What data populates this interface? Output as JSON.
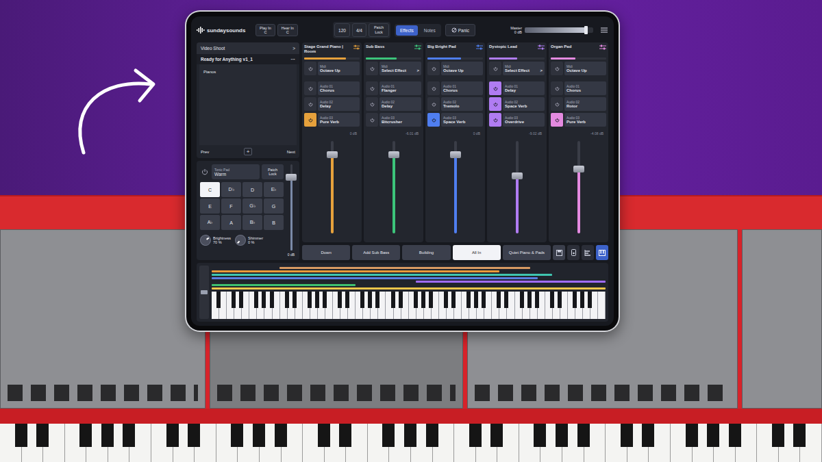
{
  "app": {
    "logo": "sundaysounds",
    "play_in": {
      "label": "Play In",
      "value": "C"
    },
    "hear_in": {
      "label": "Hear In",
      "value": "C"
    },
    "tempo": "120",
    "meter": "4/4",
    "patch_lock": "Patch Lock",
    "view_tabs": [
      {
        "label": "Effects",
        "selected": true
      },
      {
        "label": "Notes",
        "selected": false
      }
    ],
    "panic": "Panic",
    "master": {
      "label": "Master",
      "reading": "0 dB",
      "level": 0.9
    }
  },
  "setlist": {
    "title": "Video Shoot",
    "chevron": ">",
    "song": "Ready for Anything v1_1",
    "more": "···",
    "items": [
      "Pianos"
    ],
    "prev": "Prev",
    "add": "+",
    "next": "Next"
  },
  "tonic_pad": {
    "label": "Tonic Pad",
    "value": "Warm",
    "patch_lock": "Patch Lock",
    "level": 0.85,
    "reading": "0 dB",
    "keys": [
      {
        "label": "C",
        "selected": true
      },
      {
        "label": "D♭",
        "selected": false
      },
      {
        "label": "D",
        "selected": false
      },
      {
        "label": "E♭",
        "selected": false
      },
      {
        "label": "E",
        "selected": false
      },
      {
        "label": "F",
        "selected": false
      },
      {
        "label": "G♭",
        "selected": false
      },
      {
        "label": "G",
        "selected": false
      },
      {
        "label": "A♭",
        "selected": false
      },
      {
        "label": "A",
        "selected": false
      },
      {
        "label": "B♭",
        "selected": false
      },
      {
        "label": "B",
        "selected": false
      }
    ],
    "knobs": [
      {
        "label": "Brightness",
        "value": "70 %",
        "level": 0.7
      },
      {
        "label": "Shimmer",
        "value": "0 %",
        "level": 0
      }
    ]
  },
  "channels": [
    {
      "name": "Stage Grand Piano | Room",
      "color": "#e6a13c",
      "meter": 0.75,
      "midi": {
        "label": "Midi",
        "value": "Octave Up",
        "chevron": ""
      },
      "effects": [
        {
          "slot": "Audio 01",
          "name": "Chorus",
          "active": false
        },
        {
          "slot": "Audio 02",
          "name": "Delay",
          "active": false
        },
        {
          "slot": "Audio 03",
          "name": "Pure Verb",
          "active": true
        }
      ],
      "level": 0.85,
      "reading": "0 dB"
    },
    {
      "name": "Sub Bass",
      "color": "#3cc47a",
      "meter": 0.55,
      "midi": {
        "label": "Midi",
        "value": "Select Effect",
        "chevron": ">"
      },
      "effects": [
        {
          "slot": "Audio 01",
          "name": "Flanger",
          "active": false
        },
        {
          "slot": "Audio 02",
          "name": "Delay",
          "active": false
        },
        {
          "slot": "Audio 03",
          "name": "Bitcrusher",
          "active": false
        }
      ],
      "level": 0.85,
      "reading": "-6.01 dB"
    },
    {
      "name": "Big Bright Pad",
      "color": "#4f7ef0",
      "meter": 0.6,
      "midi": {
        "label": "Midi",
        "value": "Octave Up",
        "chevron": ""
      },
      "effects": [
        {
          "slot": "Audio 01",
          "name": "Chorus",
          "active": false
        },
        {
          "slot": "Audio 02",
          "name": "Tremolo",
          "active": false
        },
        {
          "slot": "Audio 03",
          "name": "Space Verb",
          "active": true
        }
      ],
      "level": 0.85,
      "reading": "0 dB"
    },
    {
      "name": "Dystopic Lead",
      "color": "#b07cf2",
      "meter": 0.5,
      "midi": {
        "label": "Midi",
        "value": "Select Effect",
        "chevron": ">"
      },
      "effects": [
        {
          "slot": "Audio 01",
          "name": "Delay",
          "active": true
        },
        {
          "slot": "Audio 02",
          "name": "Space Verb",
          "active": true
        },
        {
          "slot": "Audio 03",
          "name": "Overdrive",
          "active": true
        }
      ],
      "level": 0.62,
      "reading": "-9.02 dB"
    },
    {
      "name": "Organ Pad",
      "color": "#e48ae0",
      "meter": 0.45,
      "midi": {
        "label": "Midi",
        "value": "Octave Up",
        "chevron": ""
      },
      "effects": [
        {
          "slot": "Audio 01",
          "name": "Chorus",
          "active": false
        },
        {
          "slot": "Audio 02",
          "name": "Rotor",
          "active": false
        },
        {
          "slot": "Audio 03",
          "name": "Pure Verb",
          "active": true
        }
      ],
      "level": 0.7,
      "reading": "-4.08 dB"
    }
  ],
  "scenes": [
    {
      "label": "Down",
      "selected": false
    },
    {
      "label": "Add Sub Bass",
      "selected": false
    },
    {
      "label": "Building",
      "selected": false
    },
    {
      "label": "All In",
      "selected": true
    },
    {
      "label": "Quiet Piano & Pads",
      "selected": false
    }
  ],
  "piano_roll": {
    "pitch_level": 0.5,
    "ranges": [
      {
        "color": "#d89a62",
        "low": 9,
        "high": 42
      },
      {
        "color": "#e89a3a",
        "low": 0,
        "high": 38
      },
      {
        "color": "#3fc6b0",
        "low": 0,
        "high": 45
      },
      {
        "color": "#5a7de0",
        "low": 0,
        "high": 43
      },
      {
        "color": "#a06cff",
        "low": 27,
        "high": 52
      },
      {
        "color": "#3fbf6f",
        "low": 0,
        "high": 19
      },
      {
        "color": "#f0c64a",
        "low": 0,
        "high": 52
      }
    ]
  }
}
